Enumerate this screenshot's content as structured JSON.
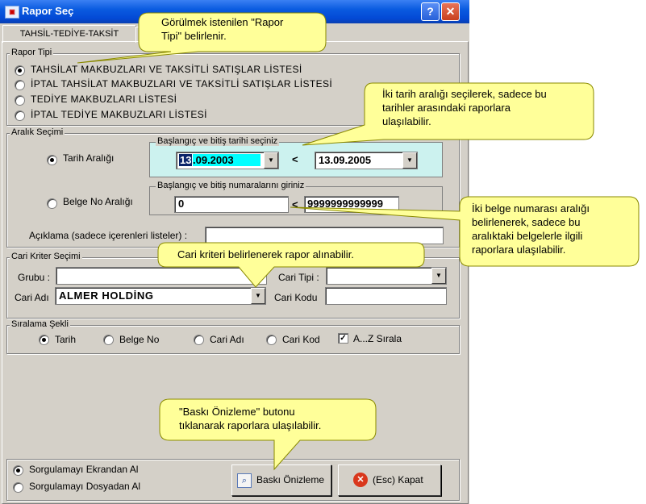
{
  "window": {
    "title": "Rapor Seç",
    "help_label": "?",
    "close_label": "✕"
  },
  "tab": {
    "label": "TAHSİL-TEDİYE-TAKSİT"
  },
  "rapor_tipi": {
    "legend": "Rapor Tipi",
    "options": [
      "TAHSİLAT MAKBUZLARI VE TAKSİTLİ SATIŞLAR LİSTESİ",
      "İPTAL TAHSİLAT MAKBUZLARI VE TAKSİTLİ SATIŞLAR LİSTESİ",
      "TEDİYE MAKBUZLARI LİSTESİ",
      "İPTAL TEDİYE MAKBUZLARI LİSTESİ"
    ]
  },
  "aralik": {
    "legend": "Aralık Seçimi",
    "tarih_label": "Tarih Aralığı",
    "tarih_group": "Başlangıç ve bitiş tarihi seçiniz",
    "start_date_sel": "13",
    "start_date_rest": ".09.2003",
    "end_date": "13.09.2005",
    "lt1": "<",
    "belge_label": "Belge No Aralığı",
    "belge_group": "Başlangıç ve bitiş numaralarını giriniz",
    "belge_start": "0",
    "belge_end": "9999999999999",
    "lt2": "<",
    "aciklama_label": "Açıklama (sadece içerenleri listeler) :",
    "aciklama_value": ""
  },
  "cari": {
    "legend": "Cari Kriter Seçimi",
    "grubu_label": "Grubu :",
    "grubu_value": "",
    "cari_tipi_label": "Cari Tipi :",
    "cari_tipi_value": "",
    "cari_adi_label": "Cari Adı",
    "cari_adi_value": "ALMER HOLDİNG",
    "cari_kodu_label": "Cari Kodu",
    "cari_kodu_value": ""
  },
  "siralama": {
    "legend": "Sıralama Şekli",
    "options": [
      "Tarih",
      "Belge No",
      "Cari Adı",
      "Cari Kod"
    ],
    "az_label": "A...Z Sırala",
    "check_mark": "✓"
  },
  "sorgu": {
    "ekran": "Sorgulamayı Ekrandan Al",
    "dosya": "Sorgulamayı Dosyadan Al"
  },
  "buttons": {
    "preview": "Baskı Önizleme",
    "close": "(Esc) Kapat",
    "close_icon": "✕"
  },
  "callouts": {
    "c1": [
      "Görülmek istenilen \"Rapor",
      "Tipi\" belirlenir."
    ],
    "c2": [
      "İki tarih aralığı seçilerek, sadece bu",
      "tarihler arasındaki raporlara",
      "ulaşılabilir."
    ],
    "c3": [
      "İki belge numarası aralığı",
      "belirlenerek, sadece bu",
      "aralıktaki belgelerle ilgili",
      "raporlara ulaşılabilir."
    ],
    "c4": [
      "Cari kriteri belirlenerek rapor alınabilir."
    ],
    "c5": [
      "\"Baskı Önizleme\" butonu",
      "tıklanarak raporlara ulaşılabilir."
    ]
  },
  "colors": {
    "title_bar": "#0a5be0",
    "callout": "#ffff99",
    "selection": "#00ffff",
    "highlight": "#0a246a"
  }
}
